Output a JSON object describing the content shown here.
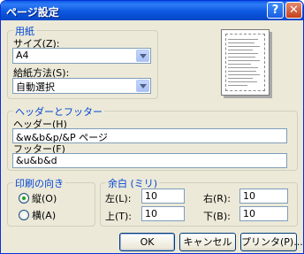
{
  "window": {
    "title": "ページ設定",
    "help_glyph": "?",
    "close_glyph": "✕"
  },
  "paper_group": {
    "legend": "用紙",
    "size_label": "サイズ(Z):",
    "size_value": "A4",
    "source_label": "給紙方法(S):",
    "source_value": "自動選択"
  },
  "header_footer_group": {
    "legend": "ヘッダーとフッター",
    "header_label": "ヘッダー(H)",
    "header_value": "&w&b&p/&P ページ",
    "footer_label": "フッター(F)",
    "footer_value": "&u&b&d"
  },
  "orientation_group": {
    "legend": "印刷の向き",
    "portrait_label": "縦(O)",
    "landscape_label": "横(A)",
    "selected": "portrait"
  },
  "margins_group": {
    "legend": "余白 (ミリ)",
    "left_label": "左(L):",
    "left_value": "10",
    "right_label": "右(R):",
    "right_value": "10",
    "top_label": "上(T):",
    "top_value": "10",
    "bottom_label": "下(B):",
    "bottom_value": "10"
  },
  "buttons": {
    "ok": "OK",
    "cancel": "キャンセル",
    "printer": "プリンタ(P)..."
  }
}
